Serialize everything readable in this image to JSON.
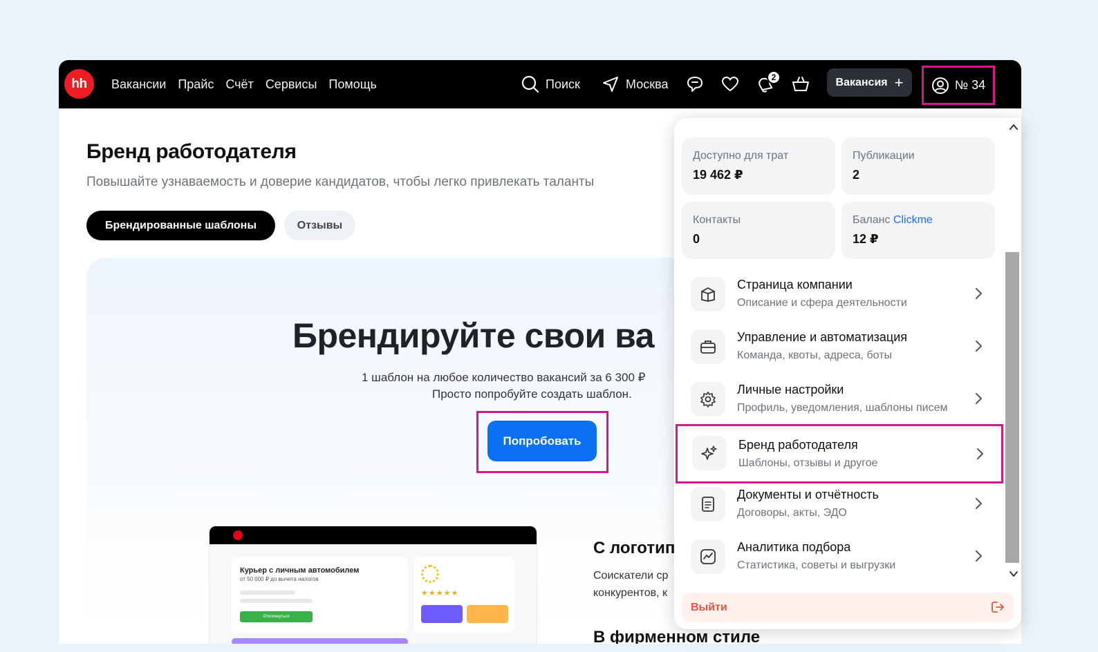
{
  "topbar": {
    "logo": "hh",
    "nav": [
      "Вакансии",
      "Прайс",
      "Счёт",
      "Сервисы",
      "Помощь"
    ],
    "search_label": "Поиск",
    "city_label": "Москва",
    "notifications_count": "2",
    "vacancy_button": "Вакансия",
    "account_label": "№ 34"
  },
  "page": {
    "title": "Бренд работодателя",
    "subtitle": "Повышайте узнаваемость и доверие кандидатов, чтобы легко привлекать таланты",
    "tabs": [
      "Брендированные шаблоны",
      "Отзывы"
    ]
  },
  "hero": {
    "title": "Брендируйте свои ва",
    "line1": "1 шаблон на любое количество вакансий за 6 300 ₽",
    "line2": "Просто попробуйте создать шаблон.",
    "cta": "Попробовать"
  },
  "mock": {
    "card_title": "Курьер с личным автомобилем",
    "card_salary": "от 50 000 ₽ до вычета налогов",
    "card_button": "Откликнуться",
    "stars": "★★★★★"
  },
  "side": {
    "heading": "С логотип",
    "line1": "Соискатели ср",
    "line2": "конкурентов, к",
    "heading2": "В фирменном стиле"
  },
  "dropdown": {
    "stats": [
      {
        "label": "Доступно для трат",
        "value": "19 462 ₽"
      },
      {
        "label": "Публикации",
        "value": "2"
      },
      {
        "label": "Контакты",
        "value": "0"
      },
      {
        "label_prefix": "Баланс ",
        "label_link": "Clickme",
        "value": "12 ₽"
      }
    ],
    "items": [
      {
        "title": "Страница компании",
        "subtitle": "Описание и сфера деятельности",
        "icon": "building-icon"
      },
      {
        "title": "Управление и автоматизация",
        "subtitle": "Команда, квоты, адреса, боты",
        "icon": "briefcase-icon"
      },
      {
        "title": "Личные настройки",
        "subtitle": "Профиль, уведомления, шаблоны писем",
        "icon": "gear-icon"
      },
      {
        "title": "Бренд работодателя",
        "subtitle": "Шаблоны, отзывы и другое",
        "icon": "sparkle-icon"
      },
      {
        "title": "Документы и отчётность",
        "subtitle": "Договоры, акты, ЭДО",
        "icon": "document-icon"
      },
      {
        "title": "Аналитика подбора",
        "subtitle": "Статистика, советы и выгрузки",
        "icon": "chart-icon"
      }
    ],
    "logout": "Выйти"
  },
  "colors": {
    "brand_red": "#ee1d23",
    "primary_blue": "#0c70f2",
    "highlight_magenta": "#d6168c",
    "logout_red": "#f0513b"
  }
}
